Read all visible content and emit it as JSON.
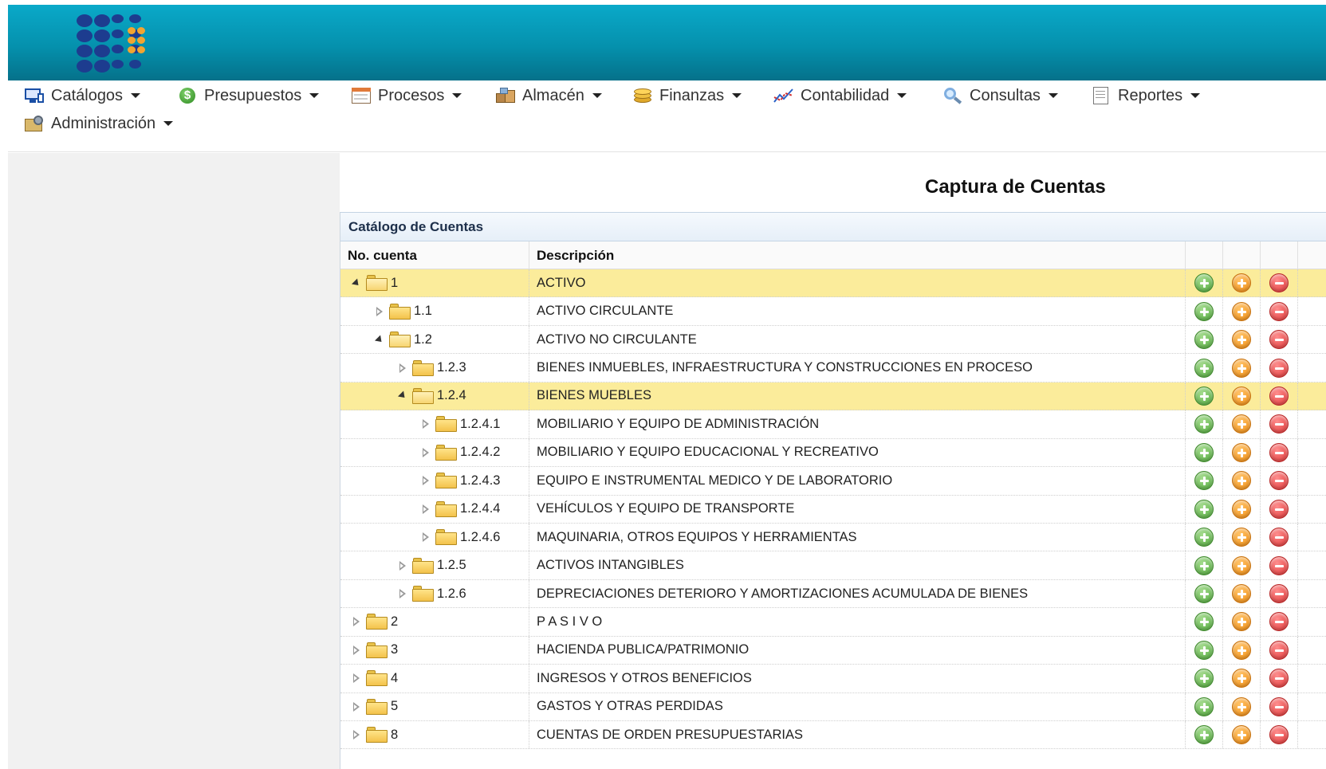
{
  "menu": {
    "items": [
      {
        "label": "Catálogos",
        "icon": "monitor-icon"
      },
      {
        "label": "Presupuestos",
        "icon": "money-icon"
      },
      {
        "label": "Procesos",
        "icon": "window-icon"
      },
      {
        "label": "Almacén",
        "icon": "boxes-icon"
      },
      {
        "label": "Finanzas",
        "icon": "coins-icon"
      },
      {
        "label": "Contabilidad",
        "icon": "chart-line-icon"
      },
      {
        "label": "Consultas",
        "icon": "magnifier-icon"
      },
      {
        "label": "Reportes",
        "icon": "document-icon"
      },
      {
        "label": "Administración",
        "icon": "admin-icon"
      }
    ]
  },
  "page": {
    "title": "Captura de Cuentas"
  },
  "grid": {
    "caption": "Catálogo de Cuentas",
    "headers": {
      "num": "No. cuenta",
      "desc": "Descripción"
    },
    "rows": [
      {
        "num": "1",
        "desc": "ACTIVO",
        "level": 0,
        "expanded": true,
        "selected": true
      },
      {
        "num": "1.1",
        "desc": "ACTIVO CIRCULANTE",
        "level": 1,
        "expanded": false,
        "selected": false
      },
      {
        "num": "1.2",
        "desc": "ACTIVO NO CIRCULANTE",
        "level": 1,
        "expanded": true,
        "selected": false
      },
      {
        "num": "1.2.3",
        "desc": "BIENES INMUEBLES, INFRAESTRUCTURA Y CONSTRUCCIONES EN PROCESO",
        "level": 2,
        "expanded": false,
        "selected": false
      },
      {
        "num": "1.2.4",
        "desc": "BIENES MUEBLES",
        "level": 2,
        "expanded": true,
        "selected": true
      },
      {
        "num": "1.2.4.1",
        "desc": "MOBILIARIO Y EQUIPO DE ADMINISTRACIÓN",
        "level": 3,
        "expanded": false,
        "selected": false
      },
      {
        "num": "1.2.4.2",
        "desc": "MOBILIARIO Y EQUIPO EDUCACIONAL Y RECREATIVO",
        "level": 3,
        "expanded": false,
        "selected": false
      },
      {
        "num": "1.2.4.3",
        "desc": "EQUIPO E INSTRUMENTAL MEDICO Y DE LABORATORIO",
        "level": 3,
        "expanded": false,
        "selected": false
      },
      {
        "num": "1.2.4.4",
        "desc": "VEHÍCULOS Y EQUIPO DE TRANSPORTE",
        "level": 3,
        "expanded": false,
        "selected": false
      },
      {
        "num": "1.2.4.6",
        "desc": "MAQUINARIA, OTROS EQUIPOS Y HERRAMIENTAS",
        "level": 3,
        "expanded": false,
        "selected": false
      },
      {
        "num": "1.2.5",
        "desc": "ACTIVOS INTANGIBLES",
        "level": 2,
        "expanded": false,
        "selected": false
      },
      {
        "num": "1.2.6",
        "desc": "DEPRECIACIONES DETERIORO Y AMORTIZACIONES ACUMULADA DE BIENES",
        "level": 2,
        "expanded": false,
        "selected": false
      },
      {
        "num": "2",
        "desc": "P A S I V O",
        "level": 0,
        "expanded": false,
        "selected": false
      },
      {
        "num": "3",
        "desc": "HACIENDA PUBLICA/PATRIMONIO",
        "level": 0,
        "expanded": false,
        "selected": false
      },
      {
        "num": "4",
        "desc": "INGRESOS Y OTROS BENEFICIOS",
        "level": 0,
        "expanded": false,
        "selected": false
      },
      {
        "num": "5",
        "desc": "GASTOS Y OTRAS PERDIDAS",
        "level": 0,
        "expanded": false,
        "selected": false
      },
      {
        "num": "8",
        "desc": "CUENTAS DE ORDEN PRESUPUESTARIAS",
        "level": 0,
        "expanded": false,
        "selected": false
      }
    ]
  },
  "colors": {
    "header": "#0591ad",
    "selected_row": "#fbec9b",
    "add": "#4fa83a",
    "edit": "#f08a0d",
    "delete": "#dd3333"
  }
}
